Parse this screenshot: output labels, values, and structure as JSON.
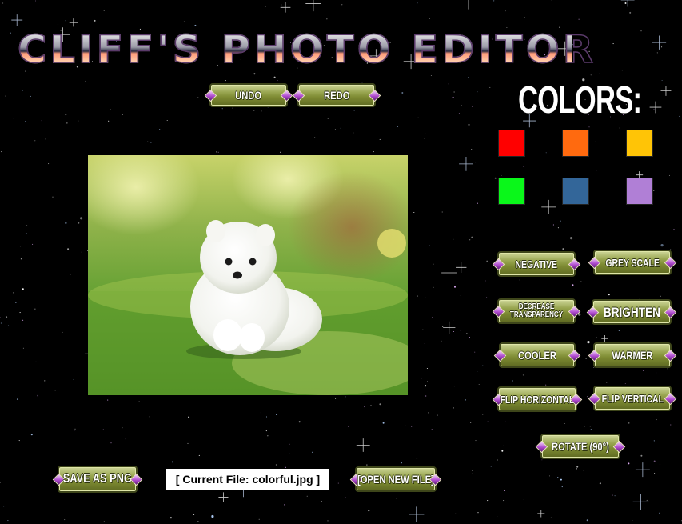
{
  "app": {
    "title": "CLIFF'S PHOTO EDITOR"
  },
  "toolbar": {
    "undo_label": "UNDO",
    "redo_label": "REDO"
  },
  "colors": {
    "heading": "COLORS:",
    "swatches": [
      {
        "name": "red",
        "hex": "#FF0000"
      },
      {
        "name": "orange",
        "hex": "#FF6A0F"
      },
      {
        "name": "yellow",
        "hex": "#FFC406"
      },
      {
        "name": "green",
        "hex": "#0AF71A"
      },
      {
        "name": "blue",
        "hex": "#336699"
      },
      {
        "name": "purple",
        "hex": "#B07FD6"
      }
    ]
  },
  "filters": {
    "negative": "NEGATIVE",
    "grey_scale": "GREY SCALE",
    "decrease_transparency": "DECREASE TRANSPARENCY",
    "brighten": "BRIGHTEN",
    "cooler": "COOLER",
    "warmer": "WARMER",
    "flip_horizontal": "FLIP HORIZONTAL",
    "flip_vertical": "FLIP VERTICAL",
    "rotate": "ROTATE (90°)"
  },
  "footer": {
    "save_label": "SAVE AS PNG",
    "current_file": "[ Current File: colorful.jpg ]",
    "open_label": "[OPEN NEW FILE]"
  },
  "image": {
    "subject": "white puppy on grass"
  },
  "theme": {
    "button_color": "#7D8A32",
    "gem_color": "#B04BD0",
    "background": "#000000"
  }
}
